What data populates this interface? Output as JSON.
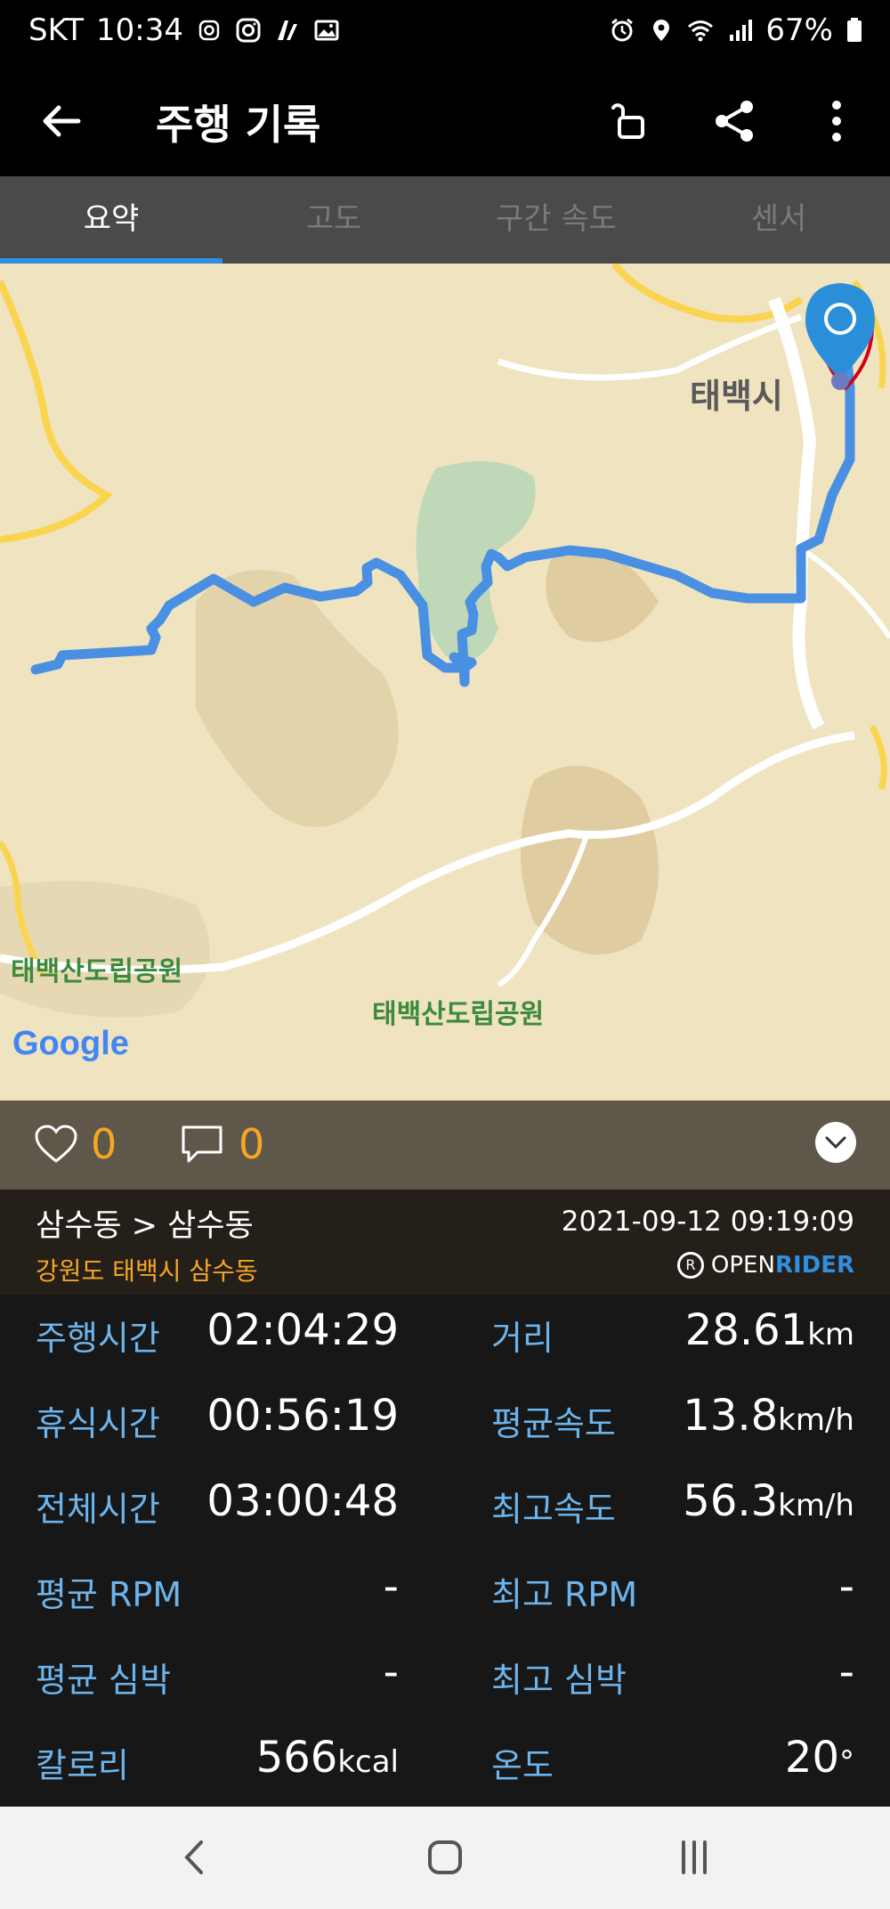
{
  "status_bar": {
    "carrier": "SKT",
    "time": "10:34",
    "battery": "67%"
  },
  "app_bar": {
    "title": "주행 기록"
  },
  "tabs": [
    {
      "label": "요약",
      "active": true
    },
    {
      "label": "고도",
      "active": false
    },
    {
      "label": "구간 속도",
      "active": false
    },
    {
      "label": "센서",
      "active": false
    }
  ],
  "map": {
    "places": [
      {
        "label": "태백시"
      },
      {
        "label": "태백산도립공원"
      },
      {
        "label": "태백산도립공원"
      }
    ],
    "attribution": "Google",
    "route_color": "#4a90e2"
  },
  "social": {
    "likes": "0",
    "comments": "0"
  },
  "route_info": {
    "route": "삼수동 > 삼수동",
    "address": "강원도 태백시 삼수동",
    "datetime": "2021-09-12 09:19:09",
    "brand_open": "OPEN",
    "brand_rider": "RIDER"
  },
  "stats": {
    "ride_time": {
      "label": "주행시간",
      "value": "02:04:29"
    },
    "distance": {
      "label": "거리",
      "value": "28.61",
      "unit": "km"
    },
    "rest_time": {
      "label": "휴식시간",
      "value": "00:56:19"
    },
    "avg_speed": {
      "label": "평균속도",
      "value": "13.8",
      "unit": "km/h"
    },
    "total_time": {
      "label": "전체시간",
      "value": "03:00:48"
    },
    "max_speed": {
      "label": "최고속도",
      "value": "56.3",
      "unit": "km/h"
    },
    "avg_rpm": {
      "label": "평균 RPM",
      "value": "-"
    },
    "max_rpm": {
      "label": "최고 RPM",
      "value": "-"
    },
    "avg_hr": {
      "label": "평균 심박",
      "value": "-"
    },
    "max_hr": {
      "label": "최고 심박",
      "value": "-"
    },
    "calories": {
      "label": "칼로리",
      "value": "566",
      "unit": "kcal"
    },
    "temperature": {
      "label": "온도",
      "value": "20",
      "unit": "°"
    }
  },
  "colors": {
    "accent_blue": "#2f8fe0",
    "label_blue": "#6cb4ec",
    "orange": "#f5a623"
  }
}
